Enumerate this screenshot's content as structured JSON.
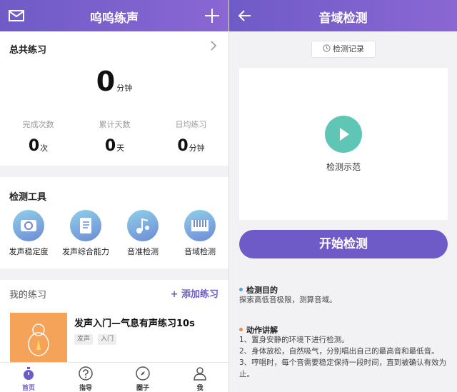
{
  "colors": {
    "brand": "#6f5bc7",
    "play": "#5fc6b6",
    "thumb": "#f6a35a",
    "dot_blue": "#4aa6e0",
    "dot_orange": "#f08a3a"
  },
  "left": {
    "header": {
      "title": "呜呜练声",
      "left_icon": "mail-icon",
      "right_icon": "plus-icon"
    },
    "total": {
      "title": "总共练习",
      "minutes": "0",
      "minutes_unit": "分钟",
      "stats": [
        {
          "label": "完成次数",
          "value": "0",
          "unit": "次"
        },
        {
          "label": "累计天数",
          "value": "0",
          "unit": "天"
        },
        {
          "label": "日均练习",
          "value": "0",
          "unit": "分钟"
        }
      ]
    },
    "tools": {
      "title": "检测工具",
      "items": [
        {
          "label": "发声稳定度",
          "icon": "gauge-icon"
        },
        {
          "label": "发声综合能力",
          "icon": "notebook-icon"
        },
        {
          "label": "音准检测",
          "icon": "music-note-icon"
        },
        {
          "label": "音域检测",
          "icon": "piano-keys-icon"
        }
      ]
    },
    "practice": {
      "title": "我的练习",
      "add_label": "+ 添加练习",
      "exercise_title": "发声入门—气息有声练习10s",
      "tags": [
        "发声",
        "入门"
      ]
    },
    "tabs": [
      {
        "label": "首页",
        "icon": "stopwatch-icon",
        "active": true
      },
      {
        "label": "指导",
        "icon": "question-icon",
        "active": false
      },
      {
        "label": "圈子",
        "icon": "compass-icon",
        "active": false
      },
      {
        "label": "我",
        "icon": "person-icon",
        "active": false
      }
    ]
  },
  "right": {
    "header": {
      "title": "音域检测",
      "back_icon": "back-arrow-icon"
    },
    "record_label": "检测记录",
    "demo_label": "检测示范",
    "start_label": "开始检测",
    "purpose": {
      "title": "检测目的",
      "text": "探索高低音极限，测算音域。"
    },
    "steps": {
      "title": "动作讲解",
      "lines": [
        "1、置身安静的环境下进行检测。",
        "2、身体放松，自然吸气，分别唱出自己的最高音和最低音。",
        "3、哼唱时，每个音需要稳定保持一段时间，直到被确认有效为止。"
      ]
    }
  }
}
